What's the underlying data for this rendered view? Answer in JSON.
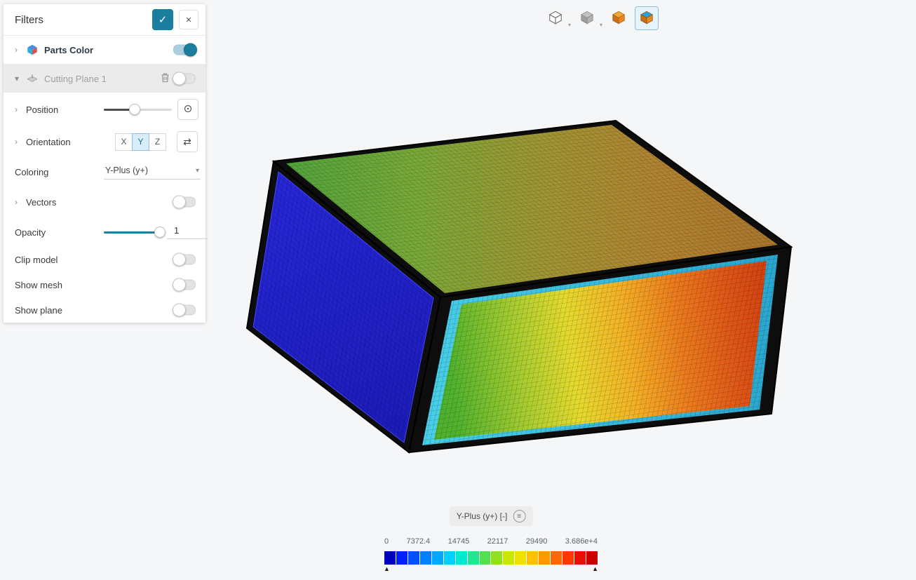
{
  "filters_panel": {
    "title": "Filters",
    "parts_color": {
      "label": "Parts Color"
    },
    "cutting_plane": {
      "label": "Cutting Plane 1"
    },
    "position": {
      "label": "Position"
    },
    "orientation": {
      "label": "Orientation",
      "axes": [
        "X",
        "Y",
        "Z"
      ],
      "selected_axis": "Y"
    },
    "coloring": {
      "label": "Coloring",
      "value": "Y-Plus (y+)"
    },
    "vectors": {
      "label": "Vectors"
    },
    "opacity": {
      "label": "Opacity",
      "value": "1"
    },
    "clip_model": {
      "label": "Clip model"
    },
    "show_mesh": {
      "label": "Show mesh"
    },
    "show_plane": {
      "label": "Show plane"
    },
    "toggles": {
      "parts_color": true,
      "cutting_plane": false,
      "vectors": false,
      "clip_model": false,
      "show_mesh": false,
      "show_plane": false
    },
    "check_glyph": "✓",
    "close_glyph": "×"
  },
  "toolbar": {
    "buttons": [
      {
        "icon": "cube-outline-icon",
        "has_dropdown": true,
        "selected": false
      },
      {
        "icon": "cube-gray-icon",
        "has_dropdown": true,
        "selected": false
      },
      {
        "icon": "cube-orange-icon",
        "has_dropdown": false,
        "selected": false
      },
      {
        "icon": "cube-section-icon",
        "has_dropdown": false,
        "selected": true
      }
    ]
  },
  "legend": {
    "title": "Y-Plus (y+) [-]",
    "menu_glyph": "≡",
    "ticks": [
      "0",
      "7372.4",
      "14745",
      "22117",
      "29490",
      "3.686e+4"
    ],
    "colorbar_colors": [
      "#0000c0",
      "#0020ff",
      "#0050ff",
      "#0080ff",
      "#00a8ff",
      "#00d0ff",
      "#00e8d0",
      "#20e890",
      "#50e050",
      "#90e020",
      "#c8e800",
      "#f0e000",
      "#ffc000",
      "#ff9800",
      "#ff6800",
      "#ff3800",
      "#e81000",
      "#c80000"
    ],
    "range_marker_glyph": "▲"
  },
  "colors": {
    "accent": "#1b7e9e",
    "selected_row_bg": "#ebebeb",
    "viewport_bg": "#f5f6f7",
    "toolbar_selected_bg": "#e7f3fa",
    "face_left_blue": "#2222cf",
    "face_ring_cyan": "#35bede"
  }
}
